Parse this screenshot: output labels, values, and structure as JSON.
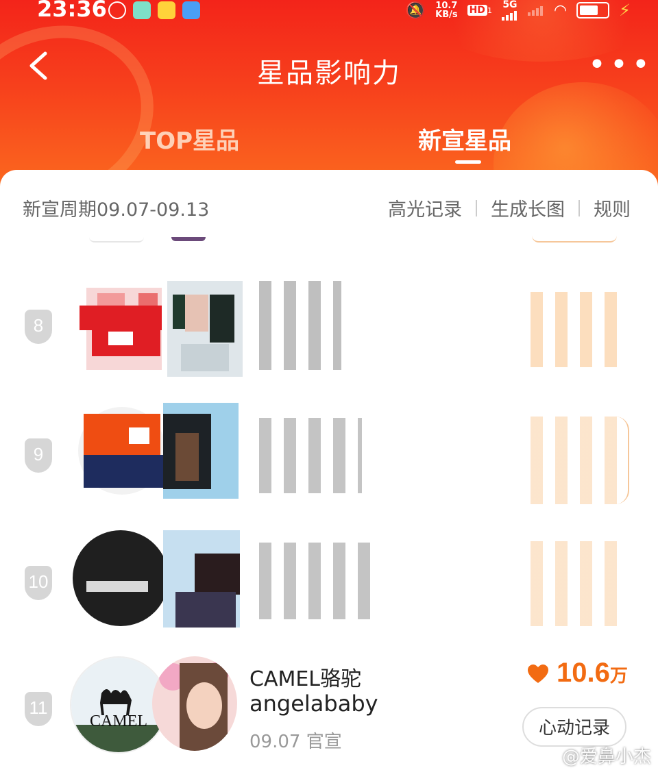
{
  "status_bar": {
    "time": "23:36",
    "net_speed_value": "10.7",
    "net_speed_unit": "KB/s",
    "hd_label": "HD",
    "hd_sub": "1",
    "network_label": "5G"
  },
  "header": {
    "title": "星品影响力",
    "more_label": "•••",
    "tabs": [
      {
        "label": "TOP星品",
        "active": false
      },
      {
        "label": "新宣星品",
        "active": true
      }
    ],
    "colors": {
      "primary": "#f3241a",
      "accent": "#fb6a1f"
    }
  },
  "info_bar": {
    "period": "新宣周期09.07-09.13",
    "links": [
      "高光记录",
      "生成长图",
      "规则"
    ]
  },
  "ranking": [
    {
      "rank": "8",
      "obscured": true
    },
    {
      "rank": "9",
      "obscured": true
    },
    {
      "rank": "10",
      "obscured": true
    },
    {
      "rank": "11",
      "obscured": false,
      "brand": "CAMEL骆驼",
      "star": "angelababy",
      "date": "09.07 官宣",
      "score": "10.6",
      "score_unit": "万",
      "button": "心动记录",
      "logo_text": "CAMEL",
      "score_color": "#f26b12"
    }
  ],
  "watermark": "@爱鼻小杰"
}
